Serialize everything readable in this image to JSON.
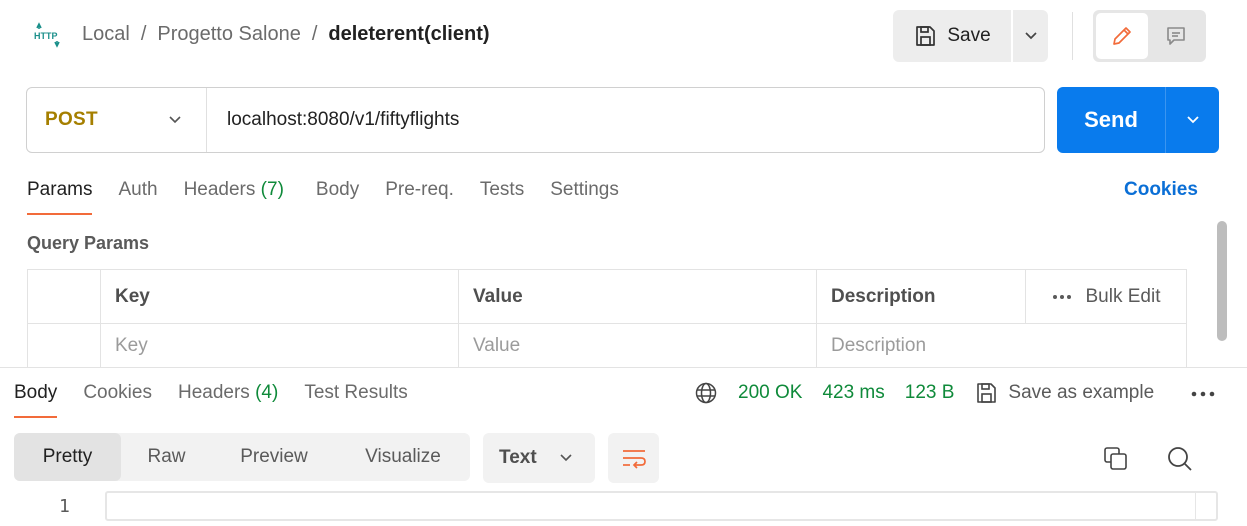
{
  "header": {
    "icon": "http-icon",
    "icon_text": "HTTP",
    "breadcrumb": [
      "Local",
      "Progetto Salone"
    ],
    "current": "deleterent(client)",
    "save_label": "Save"
  },
  "request": {
    "method": "POST",
    "url": "localhost:8080/v1/fiftyflights",
    "send_label": "Send"
  },
  "request_tabs": {
    "params": "Params",
    "auth": "Auth",
    "headers": "Headers",
    "headers_count": "(7)",
    "body": "Body",
    "prereq": "Pre-req.",
    "tests": "Tests",
    "settings": "Settings",
    "cookies": "Cookies"
  },
  "query_params": {
    "title": "Query Params",
    "columns": [
      "Key",
      "Value",
      "Description"
    ],
    "bulk_edit": "Bulk Edit",
    "placeholders": [
      "Key",
      "Value",
      "Description"
    ]
  },
  "response": {
    "tabs": {
      "body": "Body",
      "cookies": "Cookies",
      "headers": "Headers",
      "headers_count": "(4)",
      "test_results": "Test Results"
    },
    "status": "200 OK",
    "time": "423 ms",
    "size": "123 B",
    "save_example": "Save as example",
    "views": [
      "Pretty",
      "Raw",
      "Preview",
      "Visualize"
    ],
    "format": "Text",
    "line_numbers": [
      "1"
    ]
  },
  "colors": {
    "accent": "#f26b3a",
    "send": "#097bed",
    "method": "#a57f00",
    "success": "#0f8a3a",
    "link": "#0b6fd6"
  }
}
